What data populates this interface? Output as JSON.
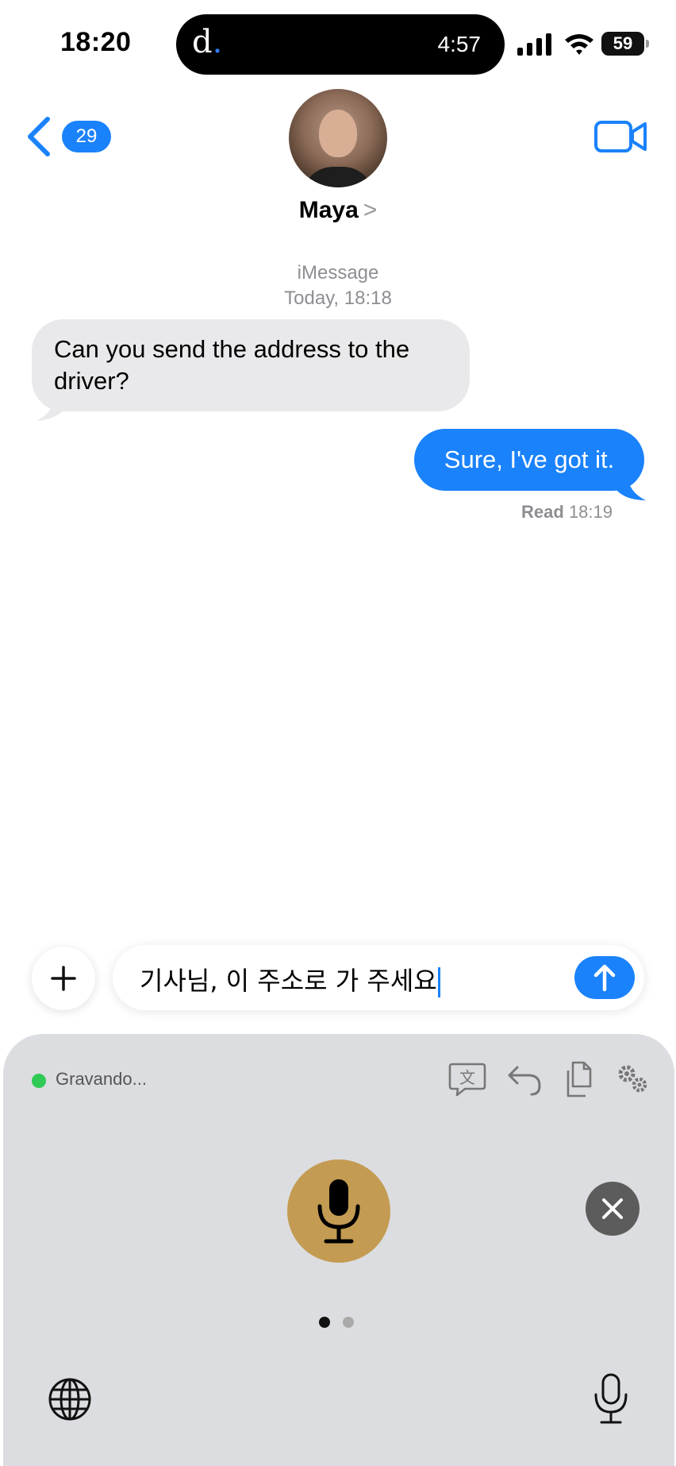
{
  "status_bar": {
    "time": "18:20",
    "island_logo": "d",
    "island_logo_dot": ".",
    "island_timer": "4:57",
    "battery": "59"
  },
  "header": {
    "back_badge": "29",
    "contact_name": "Maya",
    "contact_chevron": ">"
  },
  "conversation": {
    "service": "iMessage",
    "timestamp": "Today, 18:18",
    "messages": [
      {
        "direction": "incoming",
        "text": "Can you send the address to the driver?"
      },
      {
        "direction": "outgoing",
        "text": "Sure, I've got it."
      }
    ],
    "read_label": "Read",
    "read_time": "18:19"
  },
  "input": {
    "value": "기사님, 이 주소로 가 주세요"
  },
  "keyboard": {
    "recording_label": "Gravando...",
    "tools": [
      "translate-icon",
      "undo-icon",
      "copy-icon",
      "settings-icon"
    ],
    "page_dots_active": 1,
    "page_dots_total": 2
  },
  "colors": {
    "accent": "#1a82fb",
    "incoming_bubble": "#e9e9eb",
    "mic_button": "#c39b52",
    "recording_dot": "#2fcb54"
  }
}
